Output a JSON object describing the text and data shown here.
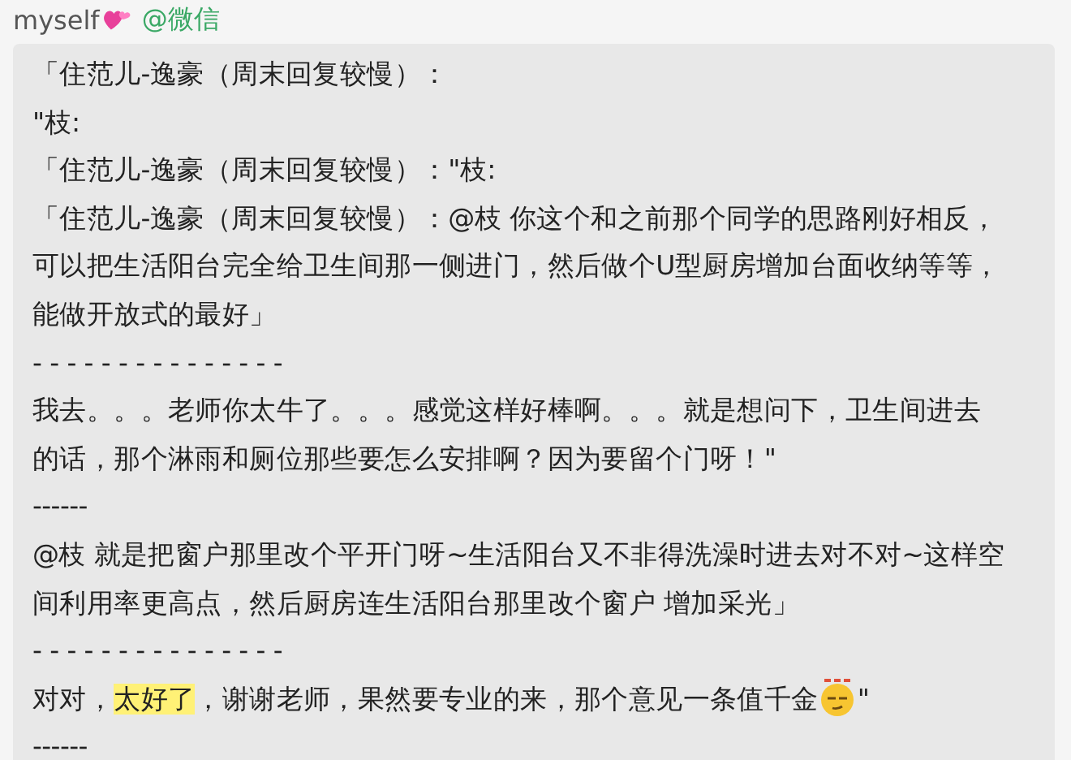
{
  "header": {
    "username": "myself",
    "source": "@微信"
  },
  "message": {
    "paragraphs": [
      {
        "lines": [
          [
            {
              "text": "「住范儿-逸豪（周末回复较慢）："
            }
          ]
        ]
      },
      {
        "lines": [
          [
            {
              "text": "\"枝:"
            }
          ]
        ]
      },
      {
        "lines": [
          [
            {
              "text": "「住范儿-逸豪（周末回复较慢）：\"枝:"
            }
          ]
        ]
      },
      {
        "lines": [
          [
            {
              "text": "「住范儿-逸豪（周末回复较慢）：@枝 你这个和之前那个同学的思路刚好相反，"
            }
          ],
          [
            {
              "text": "可以把生活阳台完全给卫生间那一侧进门，然后做个U型厨房增加台面收纳等等，"
            }
          ],
          [
            {
              "text": "能做开放式的最好」"
            }
          ]
        ]
      },
      {
        "lines": [
          [
            {
              "text": "- - - - - - - - - - - - - - -"
            }
          ]
        ]
      },
      {
        "lines": [
          [
            {
              "text": "我去。。。老师你太牛了。。。感觉这样好棒啊。。。就是想问下，卫生间进去"
            }
          ],
          [
            {
              "text": "的话，那个淋雨和厕位那些要怎么安排啊？因为要留个门呀！\""
            }
          ]
        ]
      },
      {
        "lines": [
          [
            {
              "text": "------"
            }
          ]
        ]
      },
      {
        "lines": [
          [
            {
              "text": "@枝 就是把窗户那里改个平开门呀~生活阳台又不非得洗澡时进去对不对~这样空"
            }
          ],
          [
            {
              "text": "间利用率更高点，然后厨房连生活阳台那里改个窗户 增加采光」"
            }
          ]
        ]
      },
      {
        "lines": [
          [
            {
              "text": "- - - - - - - - - - - - - - -"
            }
          ]
        ]
      },
      {
        "lines": [
          [
            {
              "text": "对对，"
            },
            {
              "text": "太好了",
              "highlight": true
            },
            {
              "text": "，谢谢老师，果然要专业的来，那个意见一条值千金"
            },
            {
              "kind": "emoji"
            },
            {
              "text": "\""
            }
          ]
        ]
      },
      {
        "lines": [
          [
            {
              "text": "------"
            }
          ]
        ]
      }
    ]
  }
}
